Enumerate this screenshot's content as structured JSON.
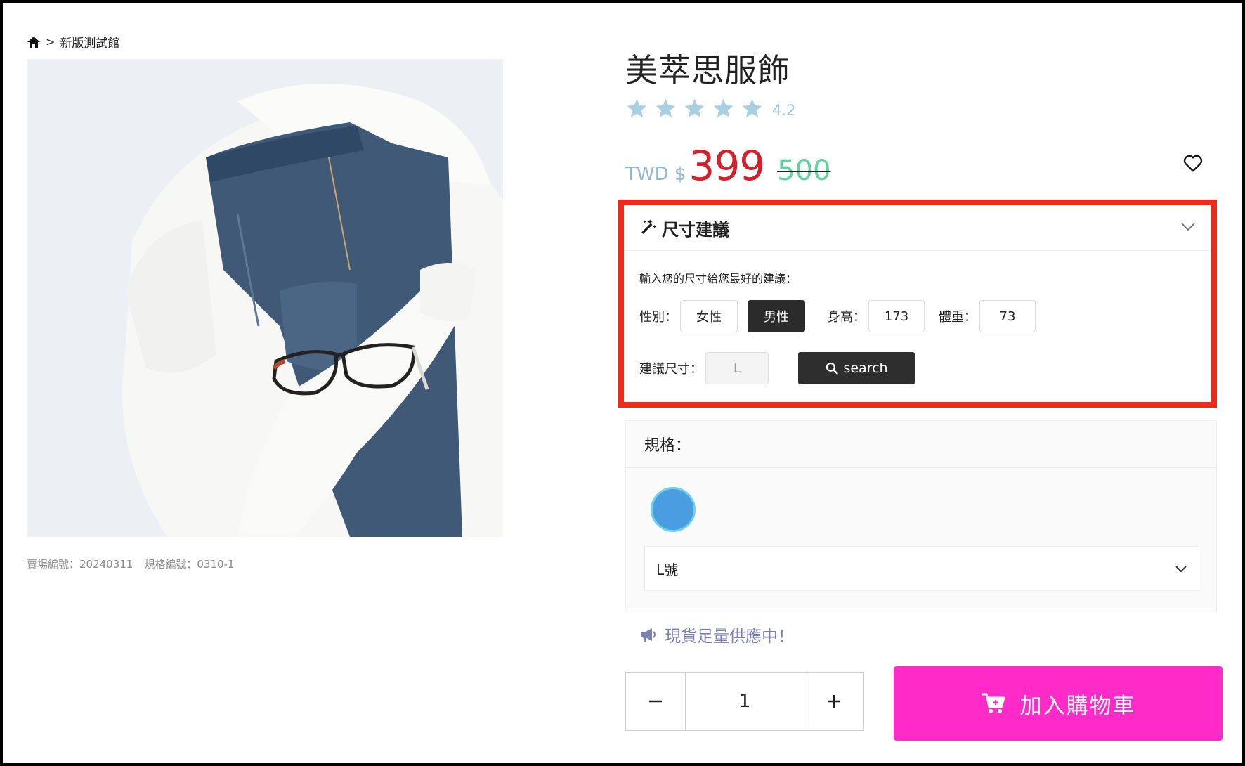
{
  "breadcrumb": {
    "home_icon": "home-icon",
    "separator": ">",
    "current": "新版測試館"
  },
  "product": {
    "title": "美萃思服飾",
    "rating": {
      "value": 4.2,
      "label": "4.2",
      "stars": 5,
      "star_color": "#a9cfe2"
    },
    "price": {
      "currency": "TWD $",
      "current": "399",
      "original": "500",
      "current_color": "#d4202a"
    },
    "codes": {
      "market_code": "賣場編號：20240311",
      "spec_code": "規格編號：0310-1"
    }
  },
  "size_advice": {
    "title": "尺寸建議",
    "hint": "輸入您的尺寸給您最好的建議：",
    "gender_label": "性別：",
    "female": "女性",
    "male": "男性",
    "selected_gender": "男性",
    "height_label": "身高：",
    "height_value": "173",
    "weight_label": "體重：",
    "weight_value": "73",
    "recommend_label": "建議尺寸：",
    "recommend_value": "L",
    "search_label": "search"
  },
  "spec": {
    "title": "規格：",
    "swatch_color": "#4a9de0",
    "selected_size": "L號"
  },
  "stock_text": "現貨足量供應中！",
  "quantity": "1",
  "cart_label": "加入購物車",
  "colors": {
    "accent_pink": "#ff2bc9",
    "highlight_border": "#ee2a1a"
  }
}
